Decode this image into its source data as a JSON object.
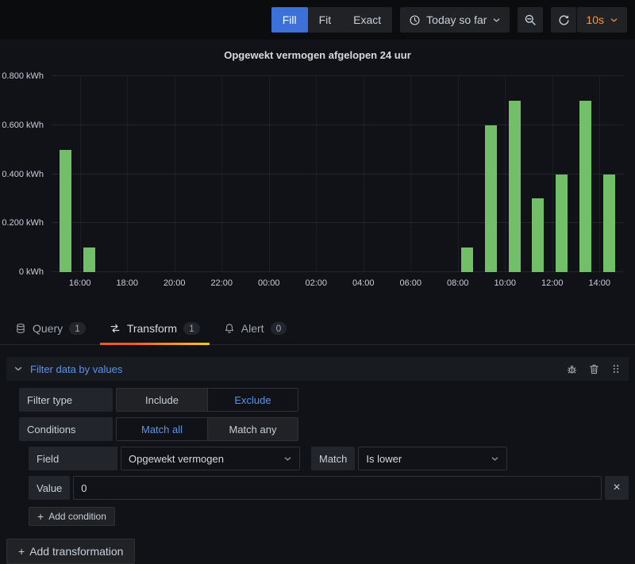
{
  "toolbar": {
    "view_modes": [
      {
        "label": "Fill",
        "selected": true
      },
      {
        "label": "Fit",
        "selected": false
      },
      {
        "label": "Exact",
        "selected": false
      }
    ],
    "time_range": {
      "label": "Today so far",
      "icon": "clock-icon"
    },
    "zoom_out": {
      "icon": "zoom-out-icon"
    },
    "refresh": {
      "icon": "refresh-icon",
      "interval": "10s"
    }
  },
  "tabs": [
    {
      "label": "Query",
      "count": "1",
      "icon": "database-icon",
      "active": false
    },
    {
      "label": "Transform",
      "count": "1",
      "icon": "transform-icon",
      "active": true
    },
    {
      "label": "Alert",
      "count": "0",
      "icon": "bell-icon",
      "active": false
    }
  ],
  "transform_editor": {
    "header": {
      "title": "Filter data by values",
      "icons": [
        "bug-icon",
        "trash-icon",
        "drag-handle-icon"
      ]
    },
    "filter_type": {
      "label": "Filter type",
      "options": [
        "Include",
        "Exclude"
      ],
      "selected": "Exclude"
    },
    "conditions": {
      "label": "Conditions",
      "options": [
        "Match all",
        "Match any"
      ],
      "selected": "Match all"
    },
    "field": {
      "label": "Field",
      "value": "Opgewekt vermogen"
    },
    "match": {
      "label": "Match",
      "value": "Is lower"
    },
    "value": {
      "label": "Value",
      "input": "0"
    },
    "add_condition_label": "Add condition",
    "add_transformation_label": "Add transformation"
  },
  "colors": {
    "accent_blue": "#5794f2",
    "selected_button_blue": "#3d71d9",
    "refresh_orange": "#ff9830",
    "bar_green": "#73bf69",
    "tab_underline_start": "#f05a28",
    "tab_underline_end": "#fbca0a"
  },
  "chart_data": {
    "type": "bar",
    "title": "Opgewekt vermogen afgelopen 24 uur",
    "ylabel": "kWh",
    "y_ticks": [
      "0 kWh",
      "0.200 kWh",
      "0.400 kWh",
      "0.600 kWh",
      "0.800 kWh"
    ],
    "ylim": [
      0,
      0.8
    ],
    "x_ticks": [
      "16:00",
      "18:00",
      "20:00",
      "22:00",
      "00:00",
      "02:00",
      "04:00",
      "06:00",
      "08:00",
      "10:00",
      "12:00",
      "14:00"
    ],
    "x_domain_hours": [
      14.8,
      39.0
    ],
    "x_wrap_hour": 15,
    "bar_width_hours": 0.5,
    "bar_offset_hours": 0.15,
    "bar_color": "#73bf69",
    "grid": true,
    "legend": false,
    "bars": [
      {
        "time": "15:00",
        "value": 0.5
      },
      {
        "time": "16:00",
        "value": 0.1
      },
      {
        "time": "08:00",
        "value": 0.1
      },
      {
        "time": "09:00",
        "value": 0.6
      },
      {
        "time": "10:00",
        "value": 0.7
      },
      {
        "time": "11:00",
        "value": 0.3
      },
      {
        "time": "12:00",
        "value": 0.4
      },
      {
        "time": "13:00",
        "value": 0.7
      },
      {
        "time": "14:00",
        "value": 0.4
      }
    ]
  }
}
